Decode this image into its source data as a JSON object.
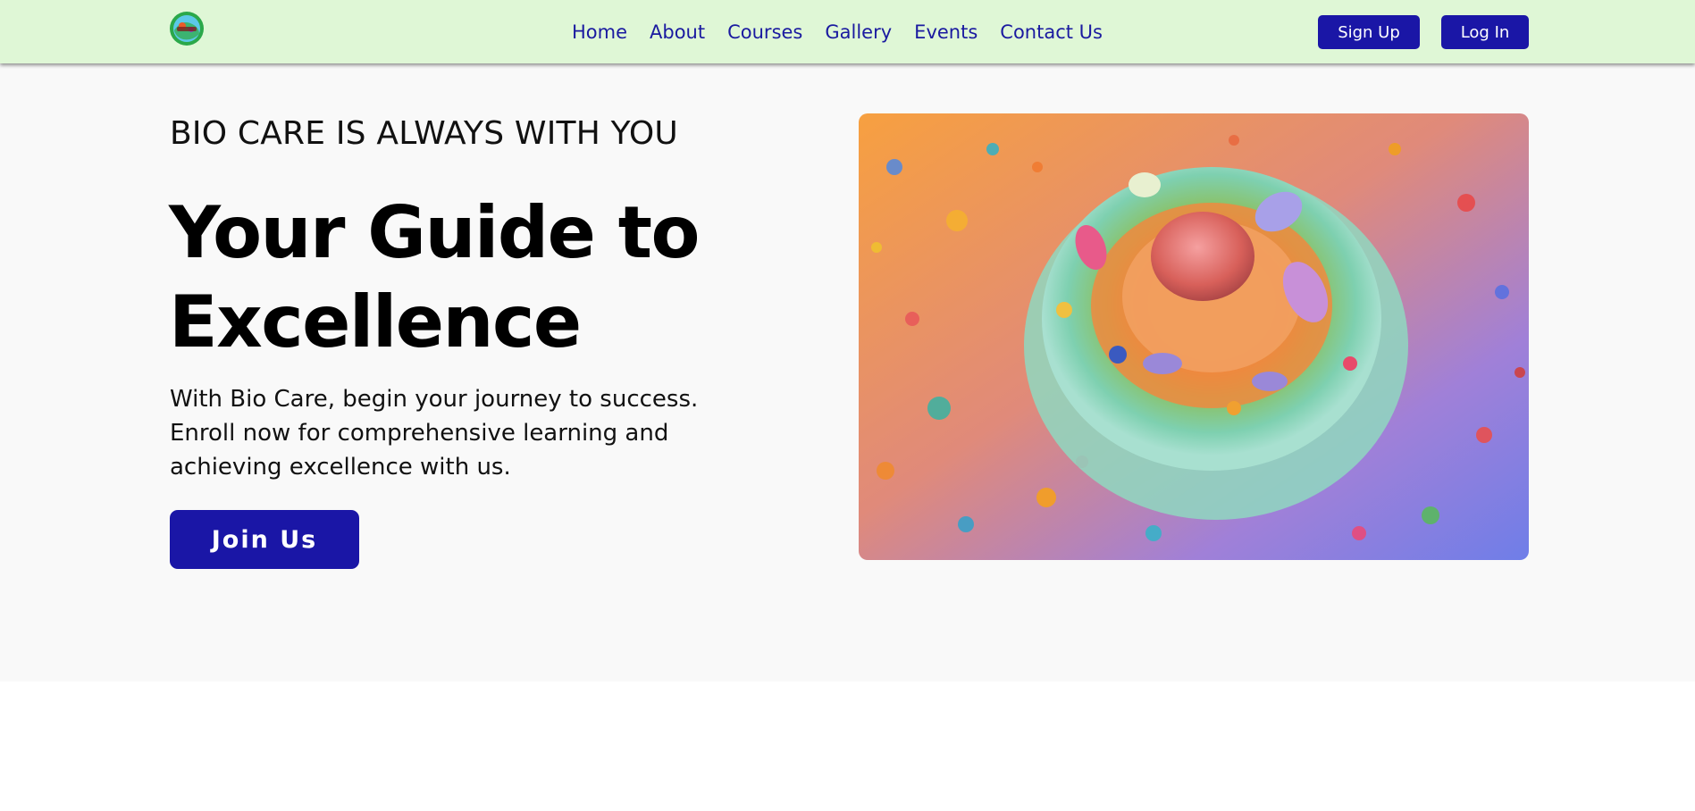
{
  "nav": {
    "logo_icon": "bio-care-logo",
    "links": [
      "Home",
      "About",
      "Courses",
      "Gallery",
      "Events",
      "Contact Us"
    ],
    "signup_label": "Sign Up",
    "login_label": "Log In"
  },
  "hero": {
    "eyebrow": "BIO CARE IS ALWAYS WITH YOU",
    "headline_line1": "Your Guide to",
    "headline_line2": "Excellence",
    "description": "With Bio Care, begin your journey to success. Enroll now for comprehensive learning and achieving excellence with us.",
    "join_label": "Join Us",
    "image_icon": "cell-illustration"
  },
  "colors": {
    "nav_background": "#dff7d6",
    "accent": "#1a16a6",
    "nav_link": "#1a1aa0",
    "hero_background": "#f9f9f9"
  }
}
